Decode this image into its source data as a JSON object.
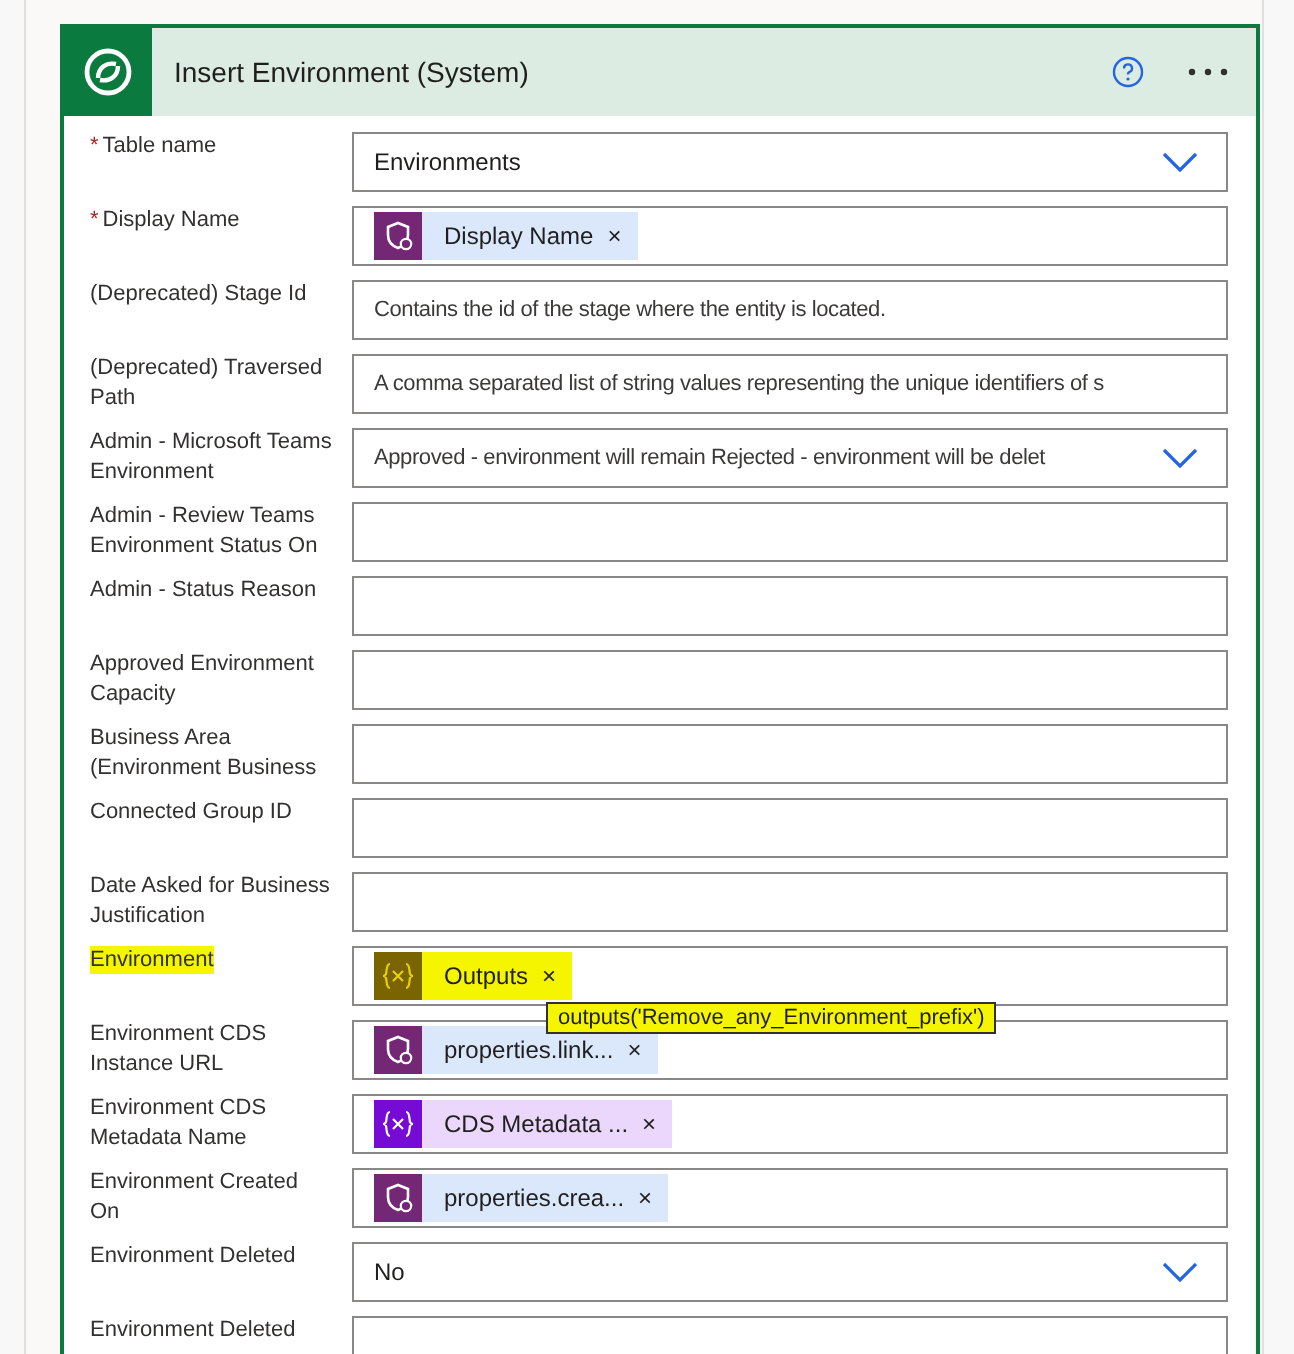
{
  "card": {
    "title": "Insert Environment (System)"
  },
  "fields": [
    {
      "label": "Table name",
      "required_mark": "*",
      "highlighted": false,
      "kind": "dropdown",
      "value": "Environments"
    },
    {
      "label": "Display Name",
      "required_mark": "*",
      "highlighted": false,
      "kind": "tokens",
      "tokens": [
        {
          "kind": "dataverse",
          "text": "Display Name",
          "remove": "×",
          "highlighted": false
        }
      ]
    },
    {
      "label": "(Deprecated) Stage Id",
      "highlighted": false,
      "kind": "text",
      "placeholder": "Contains the id of the stage where the entity is located."
    },
    {
      "label": "(Deprecated) Traversed Path",
      "highlighted": false,
      "kind": "text",
      "placeholder": "A comma separated list of string values representing the unique identifiers of s"
    },
    {
      "label": "Admin - Microsoft Teams Environment",
      "highlighted": false,
      "kind": "dropdown",
      "placeholder": "Approved - environment will remain Rejected - environment will be delet"
    },
    {
      "label": "Admin - Review Teams Environment Status On",
      "highlighted": false,
      "kind": "text"
    },
    {
      "label": "Admin - Status Reason",
      "highlighted": false,
      "kind": "text"
    },
    {
      "label": "Approved Environment Capacity",
      "highlighted": false,
      "kind": "text"
    },
    {
      "label": "Business Area (Environment Business",
      "highlighted": false,
      "kind": "text"
    },
    {
      "label": "Connected Group ID",
      "highlighted": false,
      "kind": "text"
    },
    {
      "label": "Date Asked for Business Justification",
      "highlighted": false,
      "kind": "text"
    },
    {
      "label": "Environment",
      "highlighted": true,
      "kind": "tokens",
      "tokens": [
        {
          "kind": "compose",
          "text": "Outputs",
          "remove": "×",
          "highlighted": true
        }
      ],
      "tooltip": "outputs('Remove_any_Environment_prefix')"
    },
    {
      "label": "Environment CDS Instance URL",
      "highlighted": false,
      "kind": "tokens",
      "tokens": [
        {
          "kind": "dataverse",
          "text": "properties.link...",
          "remove": "×",
          "highlighted": false
        }
      ]
    },
    {
      "label": "Environment CDS Metadata Name",
      "highlighted": false,
      "kind": "tokens",
      "tokens": [
        {
          "kind": "variable",
          "text": "CDS Metadata ...",
          "remove": "×",
          "highlighted": false
        }
      ]
    },
    {
      "label": "Environment Created On",
      "highlighted": false,
      "kind": "tokens",
      "tokens": [
        {
          "kind": "dataverse",
          "text": "properties.crea...",
          "remove": "×",
          "highlighted": false
        }
      ]
    },
    {
      "label": "Environment Deleted",
      "highlighted": false,
      "kind": "dropdown",
      "value": "No"
    },
    {
      "label": "Environment Deleted",
      "highlighted": false,
      "kind": "text"
    }
  ]
}
